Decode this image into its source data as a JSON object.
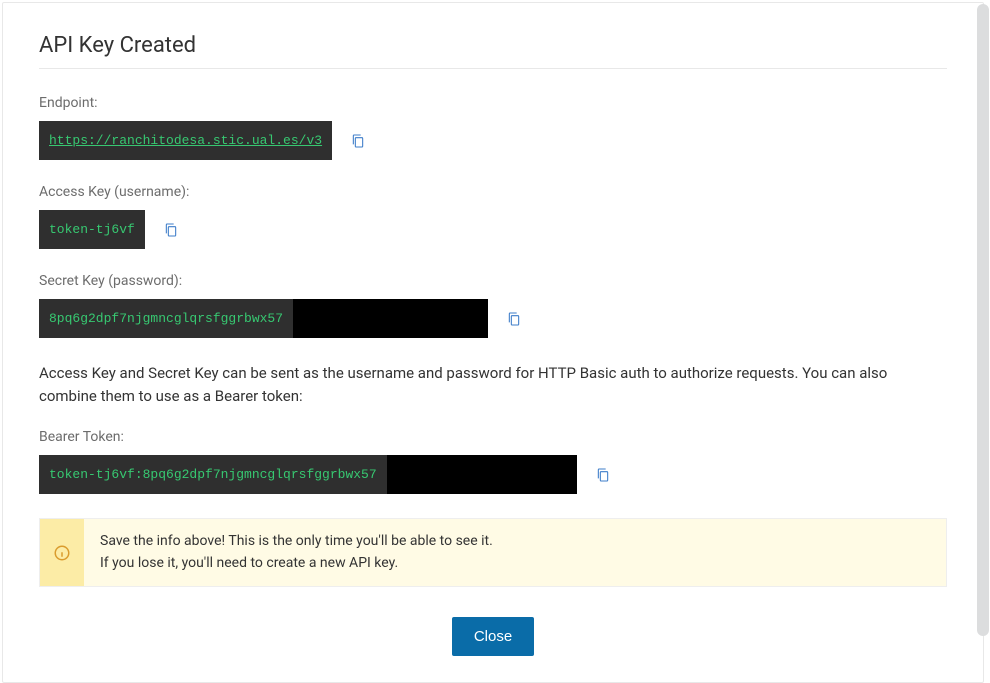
{
  "title": "API Key Created",
  "fields": {
    "endpoint": {
      "label": "Endpoint:",
      "value": "https://ranchitodesa.stic.ual.es/v3"
    },
    "access_key": {
      "label": "Access Key (username):",
      "value": "token-tj6vf"
    },
    "secret_key": {
      "label": "Secret Key (password):",
      "value": "8pq6g2dpf7njgmncglqrsfggrbwx57"
    },
    "bearer_token": {
      "label": "Bearer Token:",
      "value": "token-tj6vf:8pq6g2dpf7njgmncglqrsfggrbwx57"
    }
  },
  "description": "Access Key and Secret Key can be sent as the username and password for HTTP Basic auth to authorize requests. You can also combine them to use as a Bearer token:",
  "banner": {
    "line1": "Save the info above! This is the only time you'll be able to see it.",
    "line2": "If you lose it, you'll need to create a new API key."
  },
  "buttons": {
    "close": "Close"
  },
  "icons": {
    "copy": "clipboard-icon",
    "info": "info-icon"
  }
}
